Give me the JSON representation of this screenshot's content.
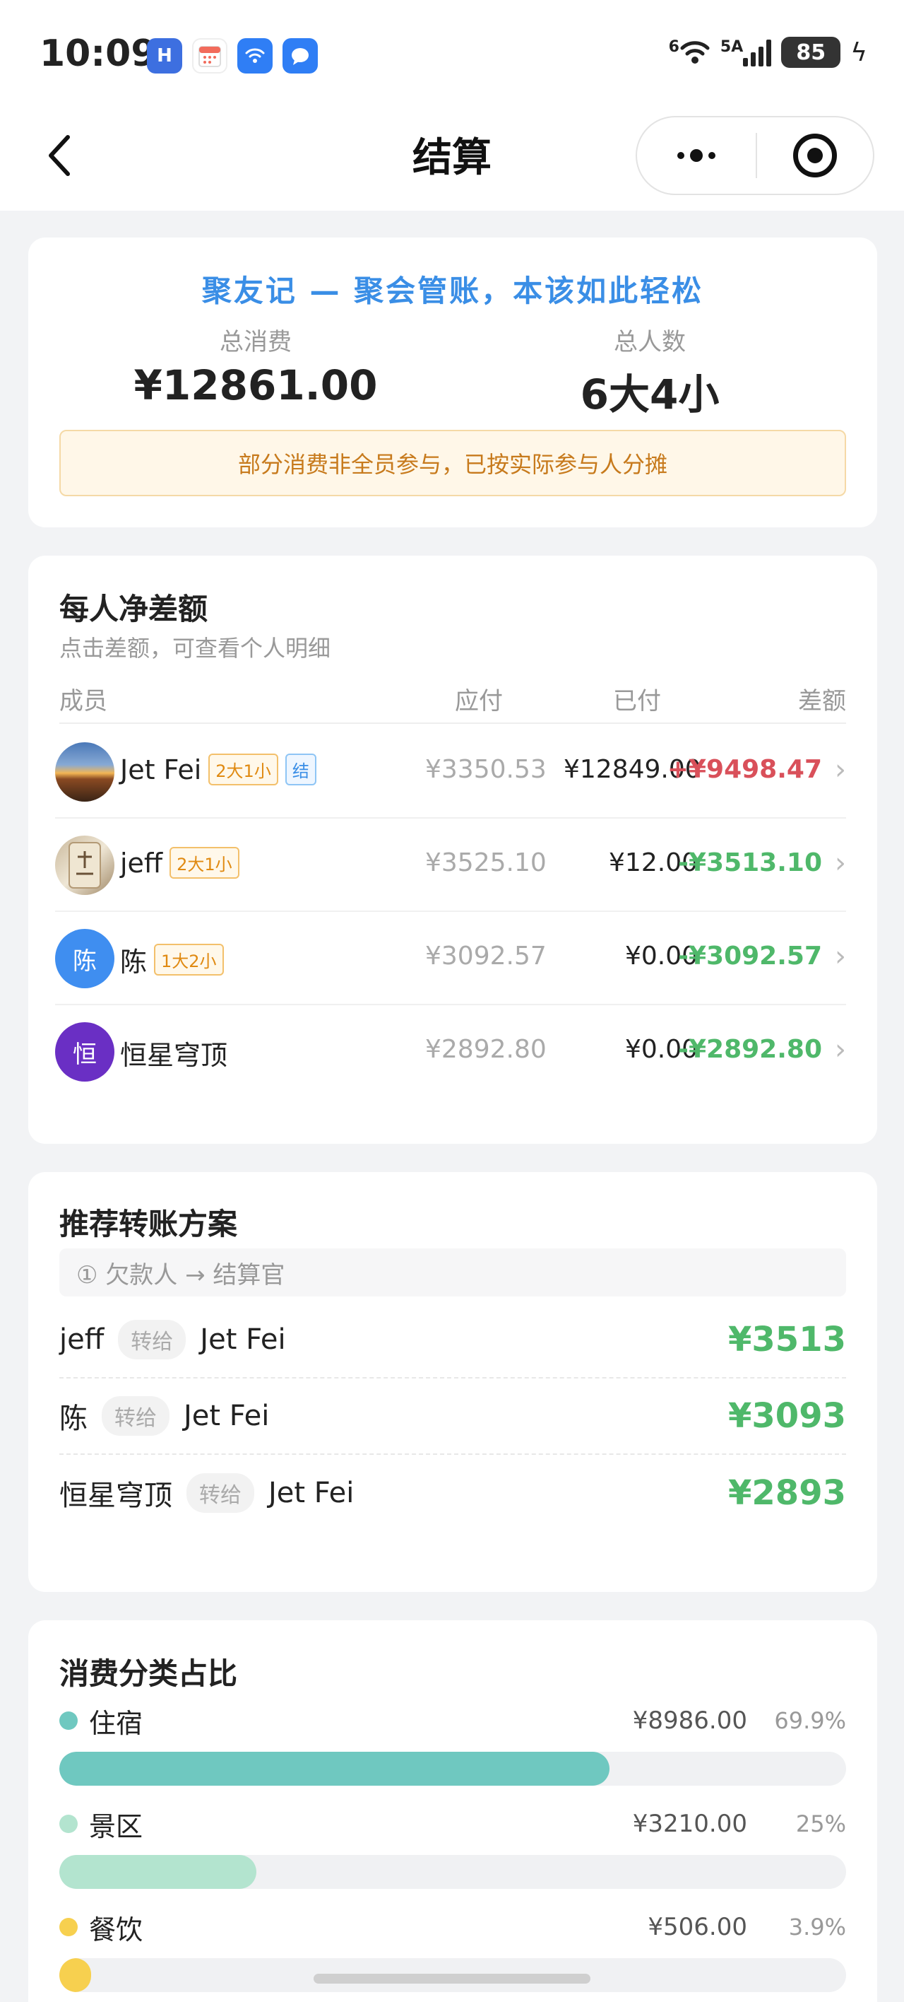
{
  "status": {
    "time": "10:09",
    "network_label": "5A",
    "wifi_label": "6",
    "battery": "85"
  },
  "nav": {
    "title": "结算"
  },
  "summary": {
    "brand": "聚友记 — 聚会管账，本该如此轻松",
    "total_label": "总消费",
    "total_value": "¥12861.00",
    "people_label": "总人数",
    "people_value": "6大4小",
    "notice": "部分消费非全员参与，已按实际参与人分摊"
  },
  "balances": {
    "title": "每人净差额",
    "subtitle": "点击差额，可查看个人明细",
    "headers": {
      "member": "成员",
      "due": "应付",
      "paid": "已付",
      "diff": "差额"
    },
    "rows": [
      {
        "name": "Jet Fei",
        "tag": "2大1小",
        "tag2": "结",
        "due": "¥3350.53",
        "paid": "¥12849.00",
        "diff": "+¥9498.47"
      },
      {
        "name": "jeff",
        "tag": "2大1小",
        "due": "¥3525.10",
        "paid": "¥12.00",
        "diff": "-¥3513.10"
      },
      {
        "name": "陈",
        "avatar_text": "陈",
        "tag": "1大2小",
        "due": "¥3092.57",
        "paid": "¥0.00",
        "diff": "-¥3092.57"
      },
      {
        "name": "恒星穹顶",
        "avatar_text": "恒",
        "due": "¥2892.80",
        "paid": "¥0.00",
        "diff": "-¥2892.80"
      }
    ]
  },
  "transfers": {
    "title": "推荐转账方案",
    "hint": "① 欠款人 → 结算官",
    "verb": "转给",
    "items": [
      {
        "from": "jeff",
        "to": "Jet Fei",
        "amount": "¥3513"
      },
      {
        "from": "陈",
        "to": "Jet Fei",
        "amount": "¥3093"
      },
      {
        "from": "恒星穹顶",
        "to": "Jet Fei",
        "amount": "¥2893"
      }
    ]
  },
  "categories": {
    "title": "消费分类占比",
    "items": [
      {
        "name": "住宿",
        "amount": "¥8986.00",
        "pct": "69.9%",
        "share": 0.699,
        "color": "#6fc8c0"
      },
      {
        "name": "景区",
        "amount": "¥3210.00",
        "pct": "25%",
        "share": 0.25,
        "color": "#b3e4cf"
      },
      {
        "name": "餐饮",
        "amount": "¥506.00",
        "pct": "3.9%",
        "share": 0.039,
        "color": "#f7d04f"
      }
    ]
  },
  "colors": {
    "brand": "#3a8ee6",
    "positive": "#d9505a",
    "negative": "#4fb86a"
  }
}
